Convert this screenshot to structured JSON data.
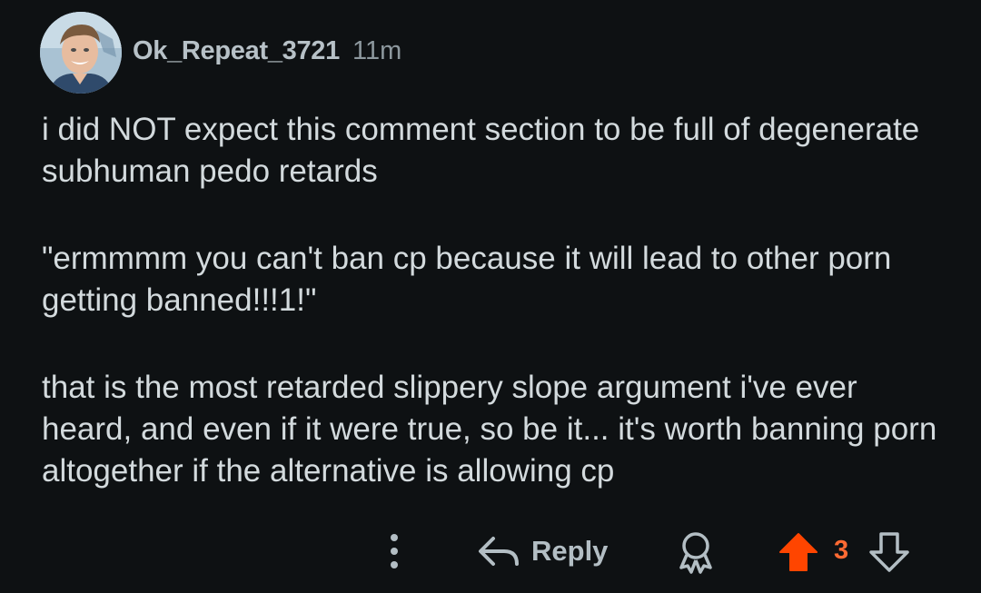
{
  "comment": {
    "username": "Ok_Repeat_3721",
    "timestamp": "11m",
    "paragraphs": [
      "i did NOT expect this comment section to be full of degenerate subhuman pedo retards",
      "\"ermmmm you can't ban cp because it will lead to other porn getting banned!!!1!\"",
      "that is the most retarded slippery slope argument i've ever heard, and even if it were true, so be it... it's worth banning porn altogether if the alternative is allowing cp"
    ]
  },
  "actions": {
    "more_icon": "vertical-ellipsis",
    "reply_icon": "reply-arrow",
    "reply_label": "Reply",
    "award_icon": "award-ribbon",
    "upvote_icon": "arrow-up-filled",
    "score": "3",
    "downvote_icon": "arrow-down-outline"
  },
  "colors": {
    "background": "#0e1113",
    "upvote_active": "#ff4500",
    "score": "#ff6a33",
    "text": "#d3dadd",
    "muted": "#8d989e"
  }
}
